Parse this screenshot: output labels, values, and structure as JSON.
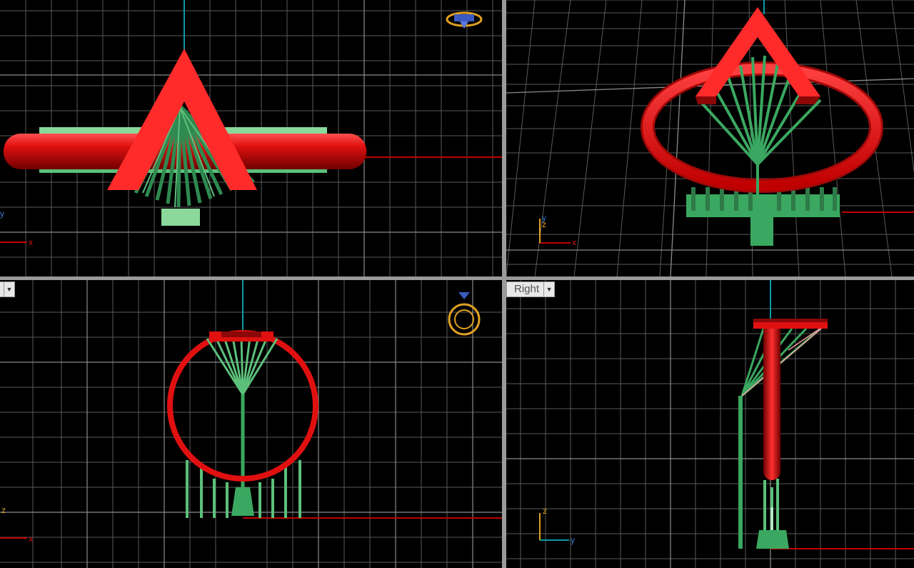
{
  "viewports": {
    "top": {
      "axis_x": "x",
      "axis_y": "y"
    },
    "perspective": {
      "axis_x": "x",
      "axis_y": "y",
      "axis_z": "z"
    },
    "front": {
      "label": "",
      "axis_x": "x",
      "axis_z": "z"
    },
    "right": {
      "label": "Right",
      "axis_y": "y",
      "axis_z": "z"
    }
  },
  "colors": {
    "background": "#000000",
    "grid": "#5a5a5a",
    "grid_major": "#8a8a8a",
    "axis_x": "#c00000",
    "axis_y": "#0a9aa8",
    "ring": "#e01010",
    "support": "#3aa860",
    "support_light": "#7fd69a",
    "view_cube": "#e0a020"
  },
  "icons": {
    "top_cube": "ring-topview-icon",
    "front_cube": "ring-frontview-icon"
  }
}
